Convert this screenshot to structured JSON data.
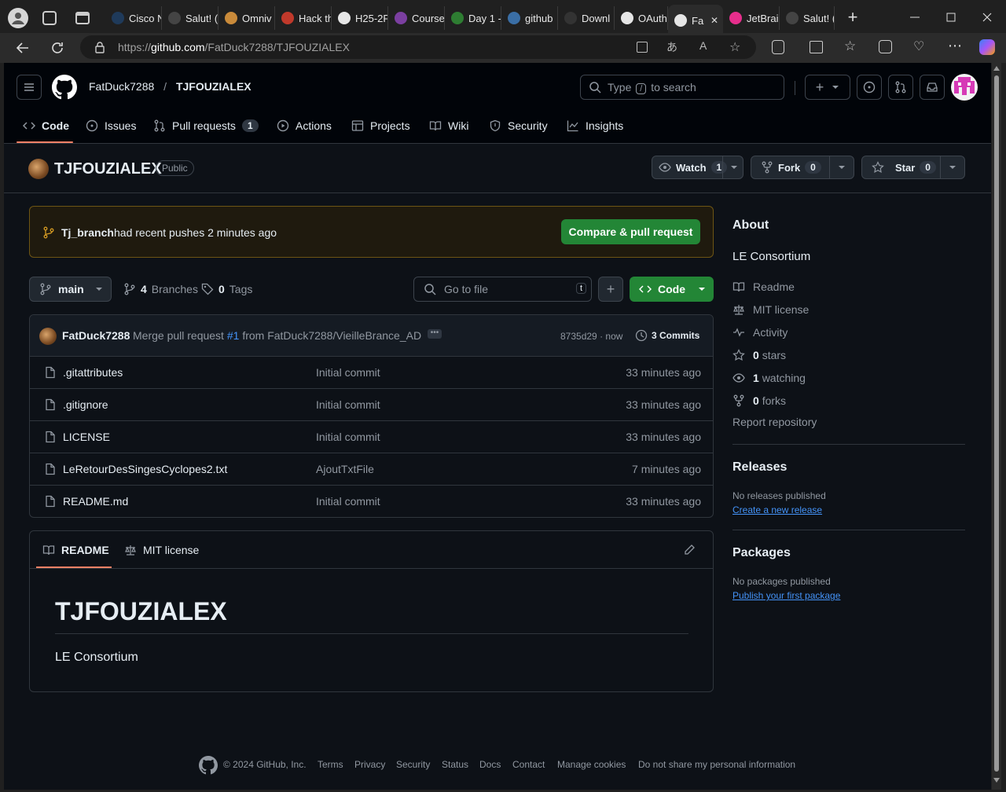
{
  "browser": {
    "tabs": [
      {
        "label": "Cisco N",
        "color": "#1f3a5a"
      },
      {
        "label": "Salut! (",
        "color": "#444"
      },
      {
        "label": "Omniv",
        "color": "#c98a3a"
      },
      {
        "label": "Hack th",
        "color": "#c0392b"
      },
      {
        "label": "H25-2F",
        "color": "#e6e6e6"
      },
      {
        "label": "Course",
        "color": "#7b3fa0"
      },
      {
        "label": "Day 1 -",
        "color": "#2e7d32"
      },
      {
        "label": "github",
        "color": "#3a6ea5"
      },
      {
        "label": "Downl",
        "color": "#333"
      },
      {
        "label": "OAuth",
        "color": "#e6e6e6"
      },
      {
        "label": "Fa",
        "color": "#e6e6e6"
      },
      {
        "label": "JetBrai",
        "color": "#e62e8c"
      },
      {
        "label": "Salut! (",
        "color": "#444"
      }
    ],
    "url_prefix": "https://",
    "url_host": "github.com",
    "url_path": "/FatDuck7288/TJFOUZIALEX"
  },
  "header": {
    "owner": "FatDuck7288",
    "separator": "/",
    "repo": "TJFOUZIALEX",
    "search_prefix": "Type",
    "search_key": "/",
    "search_suffix": "to search"
  },
  "nav": {
    "code": "Code",
    "issues": "Issues",
    "pulls": "Pull requests",
    "pulls_count": "1",
    "actions": "Actions",
    "projects": "Projects",
    "wiki": "Wiki",
    "security": "Security",
    "insights": "Insights"
  },
  "repo": {
    "name": "TJFOUZIALEX",
    "visibility": "Public",
    "watch_label": "Watch",
    "watch_count": "1",
    "fork_label": "Fork",
    "fork_count": "0",
    "star_label": "Star",
    "star_count": "0"
  },
  "banner": {
    "branch": "Tj_branch",
    "text": "had recent pushes 2 minutes ago",
    "button": "Compare & pull request"
  },
  "toolbar": {
    "branch": "main",
    "branches_count": "4",
    "branches_label": "Branches",
    "tags_count": "0",
    "tags_label": "Tags",
    "goto_placeholder": "Go to file",
    "goto_key": "t",
    "code_button": "Code"
  },
  "commit": {
    "author": "FatDuck7288",
    "message_prefix": "Merge pull request",
    "pr_link": "#1",
    "message_suffix": "from FatDuck7288/VieilleBrance_AD",
    "sha": "8735d29",
    "dot": "·",
    "time": "now",
    "commits_count": "3 Commits"
  },
  "files": [
    {
      "name": ".gitattributes",
      "message": "Initial commit",
      "time": "33 minutes ago"
    },
    {
      "name": ".gitignore",
      "message": "Initial commit",
      "time": "33 minutes ago"
    },
    {
      "name": "LICENSE",
      "message": "Initial commit",
      "time": "33 minutes ago"
    },
    {
      "name": "LeRetourDesSingesCyclopes2.txt",
      "message": "AjoutTxtFile",
      "time": "7 minutes ago"
    },
    {
      "name": "README.md",
      "message": "Initial commit",
      "time": "33 minutes ago"
    }
  ],
  "readme": {
    "tab_readme": "README",
    "tab_license": "MIT license",
    "title": "TJFOUZIALEX",
    "body": "LE Consortium"
  },
  "about": {
    "heading": "About",
    "description": "LE Consortium",
    "readme": "Readme",
    "license": "MIT license",
    "activity": "Activity",
    "stars_count": "0",
    "stars_label": "stars",
    "watching_count": "1",
    "watching_label": "watching",
    "forks_count": "0",
    "forks_label": "forks",
    "report": "Report repository"
  },
  "releases": {
    "heading": "Releases",
    "none": "No releases published",
    "create": "Create a new release"
  },
  "packages": {
    "heading": "Packages",
    "none": "No packages published",
    "publish": "Publish your first package"
  },
  "footer": {
    "copyright": "© 2024 GitHub, Inc.",
    "links": [
      "Terms",
      "Privacy",
      "Security",
      "Status",
      "Docs",
      "Contact",
      "Manage cookies",
      "Do not share my personal information"
    ]
  },
  "colors": {
    "accent_green": "#238636",
    "banner_bg": "#1f1a0e",
    "banner_border": "#6e5514",
    "link_blue": "#4493f8",
    "tab_underline": "#f78166"
  }
}
